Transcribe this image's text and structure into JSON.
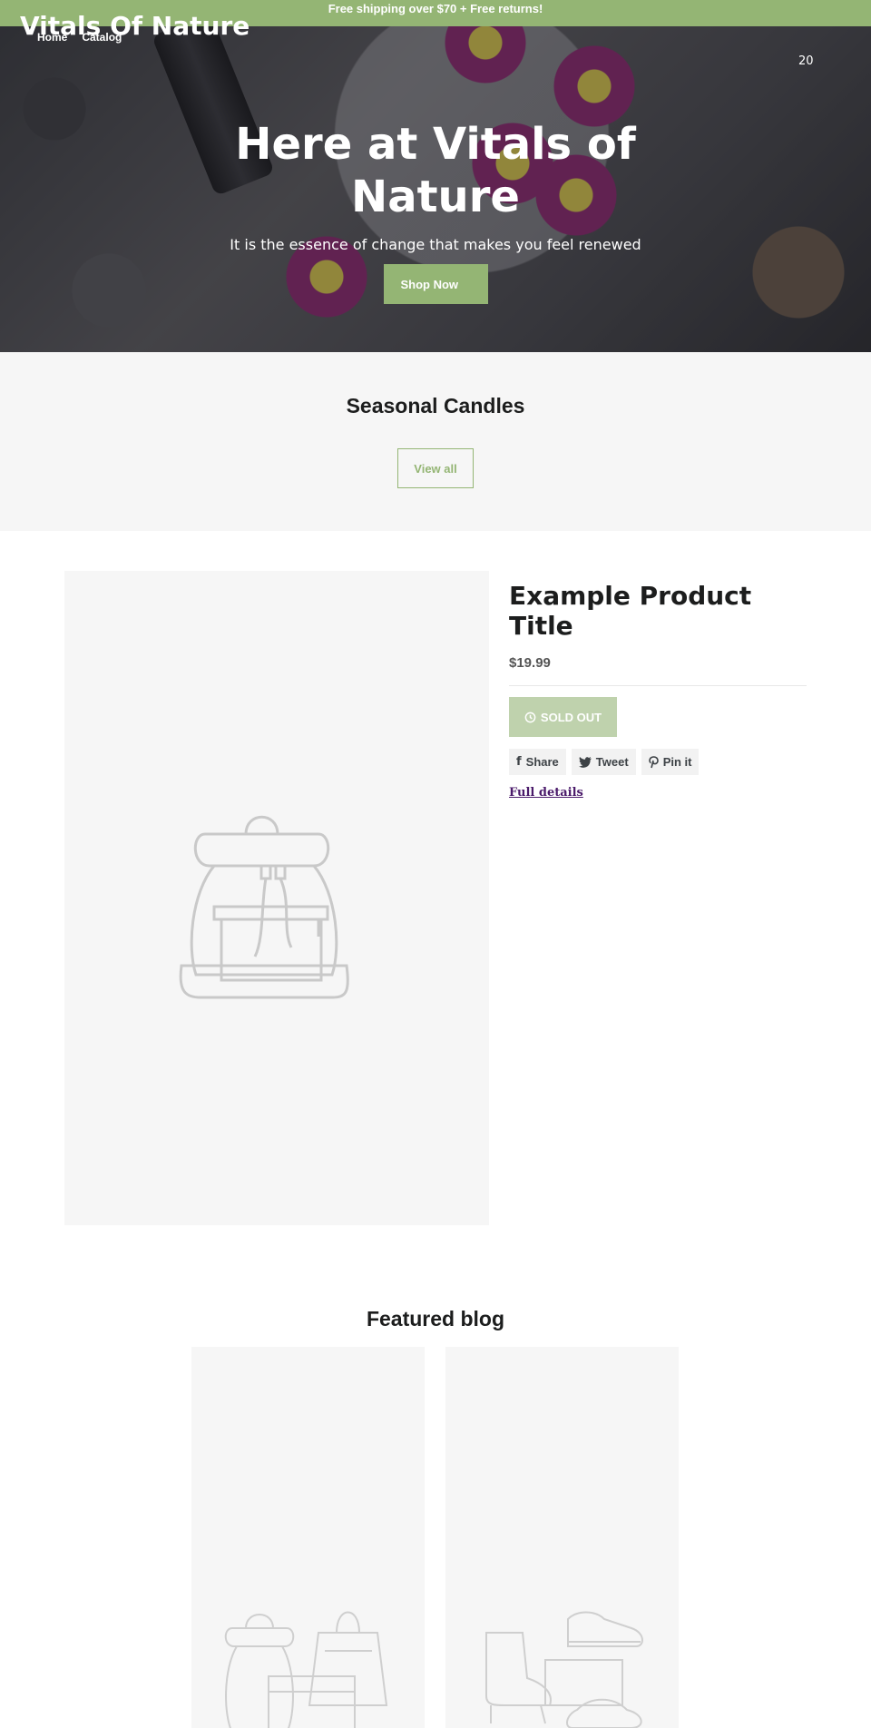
{
  "announcement": "Free shipping over $70 + Free returns!",
  "header": {
    "logo": "Vitals Of Nature",
    "nav": [
      "Home",
      "Catalog"
    ],
    "cart_count": "20"
  },
  "hero": {
    "title": "Here at Vitals of Nature",
    "subtitle": "It is the essence of change that makes you feel renewed",
    "button": "Shop Now"
  },
  "collection": {
    "title": "Seasonal Candles",
    "button": "View all"
  },
  "product": {
    "title": "Example Product Title",
    "price": "$19.99",
    "sold_out": "SOLD OUT",
    "share": "Share",
    "tweet": "Tweet",
    "pin": "Pin it",
    "full_details": "Full details"
  },
  "blog": {
    "title": "Featured blog"
  },
  "colors": {
    "accent": "#94b574",
    "sold_out_bg": "#bfd2ad",
    "placeholder_bg": "#f6f6f6",
    "link": "#4b1b6b"
  }
}
